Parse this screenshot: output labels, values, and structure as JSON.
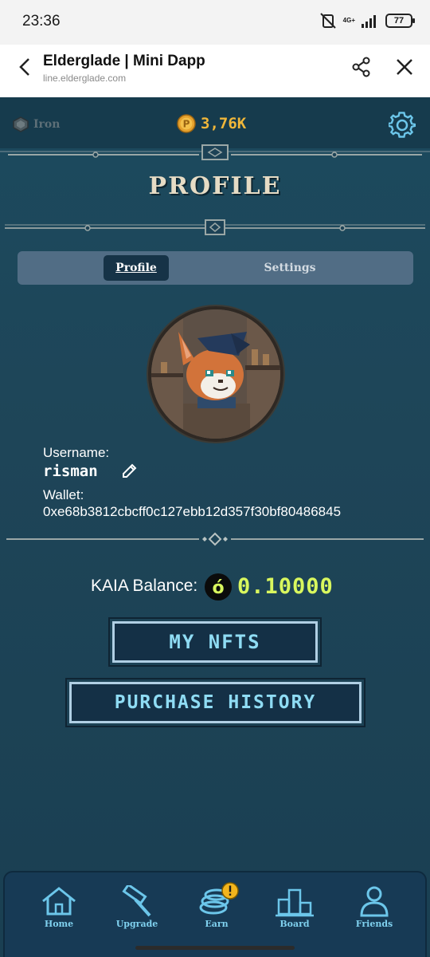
{
  "status_bar": {
    "time": "23:36",
    "network": "4G+",
    "battery": "77"
  },
  "browser": {
    "title": "Elderglade | Mini Dapp",
    "url": "line.elderglade.com"
  },
  "topbar": {
    "rank": "Iron",
    "coins": "3,76K"
  },
  "page": {
    "title": "PROFILE"
  },
  "tabs": [
    {
      "label": "Profile",
      "active": true
    },
    {
      "label": "Settings",
      "active": false
    }
  ],
  "profile": {
    "username_label": "Username:",
    "username": "risman",
    "wallet_label": "Wallet:",
    "wallet": "0xe68b3812cbcff0c127ebb12d357f30bf80486845"
  },
  "balance": {
    "label": "KAIA Balance:",
    "value": "0.10000"
  },
  "buttons": {
    "nfts": "MY NFTS",
    "history": "PURCHASE HISTORY"
  },
  "nav": [
    {
      "label": "Home",
      "icon": "home-icon"
    },
    {
      "label": "Upgrade",
      "icon": "hammer-icon"
    },
    {
      "label": "Earn",
      "icon": "coins-icon"
    },
    {
      "label": "Board",
      "icon": "podium-icon"
    },
    {
      "label": "Friends",
      "icon": "friends-icon"
    }
  ],
  "colors": {
    "accent": "#8fdcf4",
    "coin": "#f0b73a",
    "balance": "#d9f75e",
    "background": "#1d4256"
  }
}
